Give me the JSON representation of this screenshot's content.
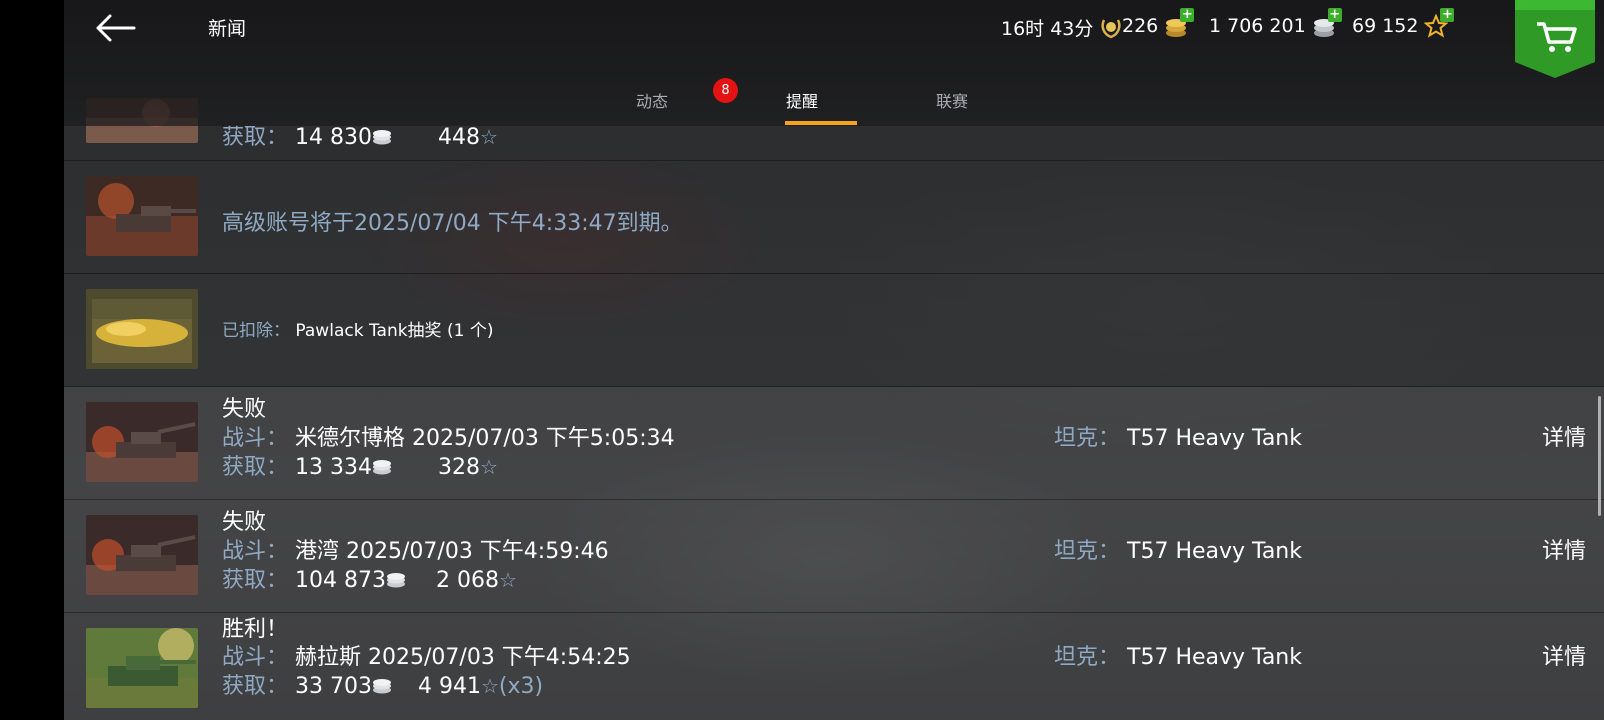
{
  "header": {
    "title": "新闻",
    "time_remaining": "16时 43分",
    "gold": "226",
    "silver": "1 706 201",
    "free_xp": "69 152"
  },
  "tabs": [
    {
      "label": "动态",
      "badge": "8"
    },
    {
      "label": "提醒",
      "active": true
    },
    {
      "label": "联赛"
    }
  ],
  "labels": {
    "earned": "获取：",
    "battle": "战斗：",
    "tank": "坦克：",
    "details": "详情",
    "deducted": "已扣除："
  },
  "rows": [
    {
      "earned_silver": "14 830",
      "earned_xp": "448"
    },
    {
      "message": "高级账号将于2025/07/04 下午4:33:47到期。"
    },
    {
      "deducted_item": "Pawlack Tank抽奖 (1 个)"
    },
    {
      "result": "失败",
      "battle": "米德尔博格 2025/07/03 下午5:05:34",
      "earned_silver": "13 334",
      "earned_xp": "328",
      "tank": "T57 Heavy Tank"
    },
    {
      "result": "失败",
      "battle": "港湾 2025/07/03 下午4:59:46",
      "earned_silver": "104 873",
      "earned_xp": "2 068",
      "tank": "T57 Heavy Tank"
    },
    {
      "result": "胜利！",
      "battle": "赫拉斯 2025/07/03 下午4:54:25",
      "earned_silver": "33 703",
      "earned_xp": "4 941",
      "xp_multiplier": "(x3)",
      "tank": "T57 Heavy Tank"
    }
  ],
  "colors": {
    "accent": "#f5a31a",
    "label": "#8fa9c4",
    "badge": "#e51212",
    "shop": "#2f9a26"
  }
}
